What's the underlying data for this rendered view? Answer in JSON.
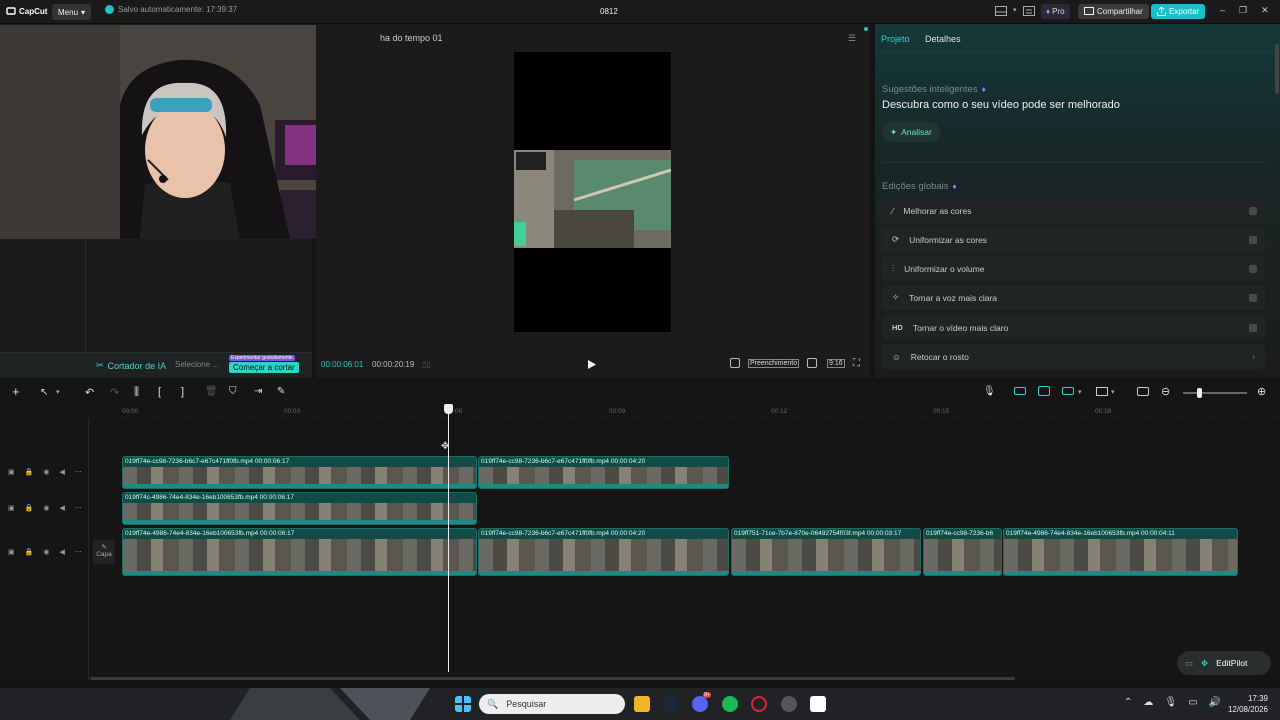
{
  "app": {
    "logo": "CapCut",
    "menu_label": "Menu",
    "autosave": "Salvo automaticamente: 17:39:37",
    "title": "0812"
  },
  "topbar": {
    "pro_label": "Pro",
    "share_label": "Compartilhar",
    "export_label": "Exportar"
  },
  "player": {
    "title": "ha do tempo 01",
    "current_time": "00:00:06:01",
    "total_time": "00:00:20:19",
    "fill_label": "Preenchimento",
    "ratio": "9:16"
  },
  "left_panel": {
    "ai_cutter": "Cortador de IA",
    "select_label": "Selecione ...",
    "promo_badge": "Experimentar gratuitamente",
    "start_cut": "Começar a cortar"
  },
  "right_panel": {
    "tabs": [
      "Projeto",
      "Detalhes"
    ],
    "smart_title": "Sugestões inteligentes",
    "smart_desc": "Descubra como o seu vídeo pode ser melhorado",
    "analyze": "Analisar",
    "global_title": "Edições globais",
    "edits": [
      {
        "label": "Melhorar as cores",
        "icon": "magic-wand-icon"
      },
      {
        "label": "Uniformizar as cores",
        "icon": "color-match-icon"
      },
      {
        "label": "Uniformizar o volume",
        "icon": "sliders-icon"
      },
      {
        "label": "Tornar a voz mais clara",
        "icon": "sparkle-icon"
      },
      {
        "label": "Tornar o vídeo mais claro",
        "icon": "hd-icon"
      },
      {
        "label": "Retocar o rosto",
        "icon": "face-icon"
      }
    ]
  },
  "ruler": [
    "00:00",
    "00:03",
    "00:06",
    "00:09",
    "00:12",
    "00:15",
    "00:18"
  ],
  "tracks": {
    "cover_label": "Capa",
    "clips": [
      {
        "label": "019ff74e-cc98-7236-b6c7-e67c471ff0fb.mp4   00:00:06:17"
      },
      {
        "label": "019ff74e-cc98-7236-b6c7-e67c471ff0fb.mp4   00:00:04:20"
      },
      {
        "label": "019ff74c-4986-74e4-834e-16eb100653fb.mp4   00:00:06:17"
      },
      {
        "label": "019ff74e-4986-74e4-834e-16eb100653fb.mp4   00:00:06:17"
      },
      {
        "label": "019ff74e-cc98-7236-b6c7-e67c471ff0fb.mp4   00:00:04:20"
      },
      {
        "label": "019ff751-71ce-7b7e-870e-06492754f03f.mp4   00:00:03:17"
      },
      {
        "label": "019ff74e-cc98-7236-b6"
      },
      {
        "label": "019ff74e-4986-74e4-834e-16eb100653fb.mp4   00:00:04:11"
      }
    ]
  },
  "editpilot": "EditPilot",
  "taskbar": {
    "search_placeholder": "Pesquisar",
    "time": "17:39",
    "date": "12/08/2026",
    "discord_badge": "9+"
  }
}
